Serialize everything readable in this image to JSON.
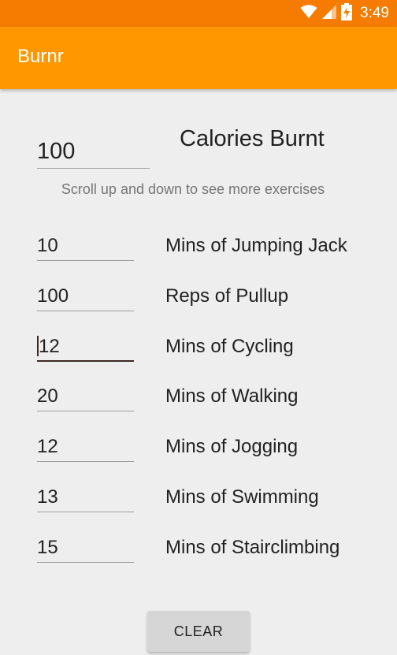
{
  "status_bar": {
    "time": "3:49",
    "icons": [
      "wifi-icon",
      "signal-icon",
      "battery-charging-icon"
    ],
    "color": "#f57c00"
  },
  "app_bar": {
    "title": "Burnr",
    "color": "#ff9800"
  },
  "calories": {
    "value": "100",
    "label": "Calories Burnt"
  },
  "hint": "Scroll up and down to see more exercises",
  "exercises": [
    {
      "value": "10",
      "label": "Mins of Jumping Jack"
    },
    {
      "value": "100",
      "label": "Reps of Pullup"
    },
    {
      "value": "12",
      "label": "Mins of Cycling",
      "focused": true
    },
    {
      "value": "20",
      "label": "Mins of Walking"
    },
    {
      "value": "12",
      "label": "Mins of Jogging"
    },
    {
      "value": "13",
      "label": "Mins of Swimming"
    },
    {
      "value": "15",
      "label": "Mins of Stairclimbing"
    }
  ],
  "clear_button": "CLEAR"
}
